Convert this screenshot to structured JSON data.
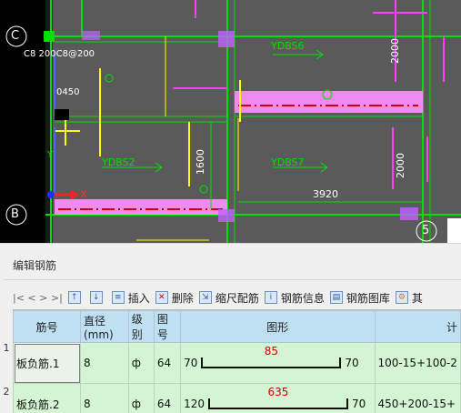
{
  "cad": {
    "axis_c": "C",
    "axis_b": "B",
    "axis_5": "5",
    "rebar_note": "C8 200C8@200",
    "small_dim": "0450",
    "axis_x": "X",
    "axis_y": "Y",
    "labels": [
      "YDBS6",
      "YDBS2",
      "YDBS7"
    ],
    "dims": [
      "2000",
      "1600",
      "2000",
      "3920"
    ],
    "colors": {
      "background": "#5a5a5a",
      "green": "#00e000",
      "magenta": "#ff40ff",
      "yellow": "#ffff00",
      "pink": "#ff80ff"
    }
  },
  "panel": {
    "title": "编辑钢筋",
    "nav": "|< < > >|",
    "toolbar": [
      {
        "icon": "insert-icon",
        "label": "插入"
      },
      {
        "icon": "delete-icon",
        "label": "删除"
      },
      {
        "icon": "scale-rebar-icon",
        "label": "缩尺配筋"
      },
      {
        "icon": "rebar-info-icon",
        "label": "钢筋信息"
      },
      {
        "icon": "rebar-library-icon",
        "label": "钢筋图库"
      },
      {
        "icon": "other-icon",
        "label": "其"
      }
    ],
    "columns": [
      "筋号",
      "直径(mm)",
      "级别",
      "图号",
      "图形",
      "计"
    ],
    "rows": [
      {
        "num": "1",
        "name": "板负筋.1",
        "diameter": "8",
        "grade": "ф",
        "fig": "64",
        "left": "70",
        "length": "85",
        "right": "70",
        "calc": "100-15+100-2"
      },
      {
        "num": "2",
        "name": "板负筋.2",
        "diameter": "8",
        "grade": "ф",
        "fig": "64",
        "left": "120",
        "length": "635",
        "right": "70",
        "calc": "450+200-15+"
      }
    ]
  }
}
